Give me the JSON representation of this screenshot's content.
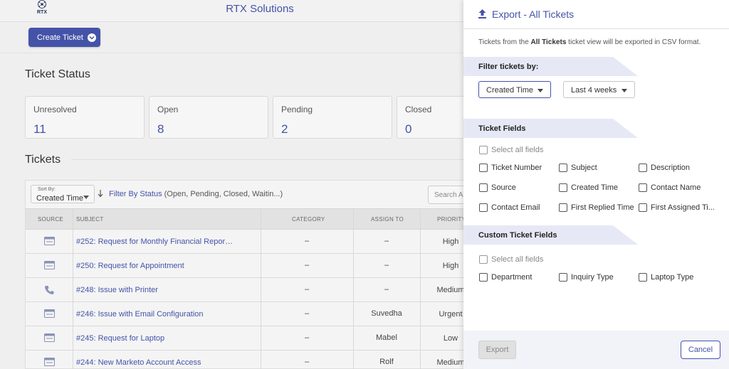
{
  "app": {
    "logo_text": "RTX",
    "title": "RTX Solutions",
    "create_ticket_label": "Create Ticket",
    "ticket_status_title": "Ticket Status",
    "status_cards": [
      {
        "label": "Unresolved",
        "value": "11"
      },
      {
        "label": "Open",
        "value": "8"
      },
      {
        "label": "Pending",
        "value": "2"
      },
      {
        "label": "Closed",
        "value": "0"
      }
    ],
    "tickets_title": "Tickets",
    "sort": {
      "caption": "Sort By:",
      "value": "Created Time"
    },
    "sort_direction_icon": "arrow-down-icon",
    "filter_link": "Filter By Status",
    "filter_values": "(Open, Pending, Closed, Waitin...)",
    "search_placeholder": "Search All",
    "columns": [
      "SOURCE",
      "SUBJECT",
      "CATEGORY",
      "ASSIGN TO",
      "PRIORITY"
    ],
    "rows": [
      {
        "source": "email-icon",
        "subject": "#252: Request for Monthly Financial Repor…",
        "category": "–",
        "assign": "–",
        "priority": "High"
      },
      {
        "source": "email-icon",
        "subject": "#250: Request for Appointment",
        "category": "–",
        "assign": "–",
        "priority": "High"
      },
      {
        "source": "phone-icon",
        "subject": "#248: Issue with Printer",
        "category": "–",
        "assign": "–",
        "priority": "Medium"
      },
      {
        "source": "email-icon",
        "subject": "#246: Issue with Email Configuration",
        "category": "–",
        "assign": "Suvedha",
        "priority": "Urgent"
      },
      {
        "source": "email-icon",
        "subject": "#245: Request for Laptop",
        "category": "–",
        "assign": "Mabel",
        "priority": "Low"
      },
      {
        "source": "email-icon",
        "subject": "#244: New Marketo Account Access",
        "category": "–",
        "assign": "Rolf",
        "priority": "Medium"
      }
    ]
  },
  "drawer": {
    "icon": "upload-icon",
    "title": "Export - All Tickets",
    "desc_prefix": "Tickets from the ",
    "desc_view": "All Tickets",
    "desc_suffix": " ticket view will be exported in CSV format.",
    "filter_section": "Filter tickets by:",
    "filter_field": "Created Time",
    "filter_range": "Last 4 weeks",
    "fields_section": "Ticket Fields",
    "select_all": "Select all fields",
    "fields": [
      "Ticket Number",
      "Subject",
      "Description",
      "Source",
      "Created Time",
      "Contact Name",
      "Contact Email",
      "First Replied Time",
      "First Assigned Ti..."
    ],
    "custom_section": "Custom Ticket Fields",
    "custom_select_all": "Select all fields",
    "custom_fields": [
      "Department",
      "Inquiry Type",
      "Laptop Type"
    ],
    "export_label": "Export",
    "cancel_label": "Cancel"
  },
  "colors": {
    "accent": "#4453a8",
    "band": "#e6e9f5"
  }
}
